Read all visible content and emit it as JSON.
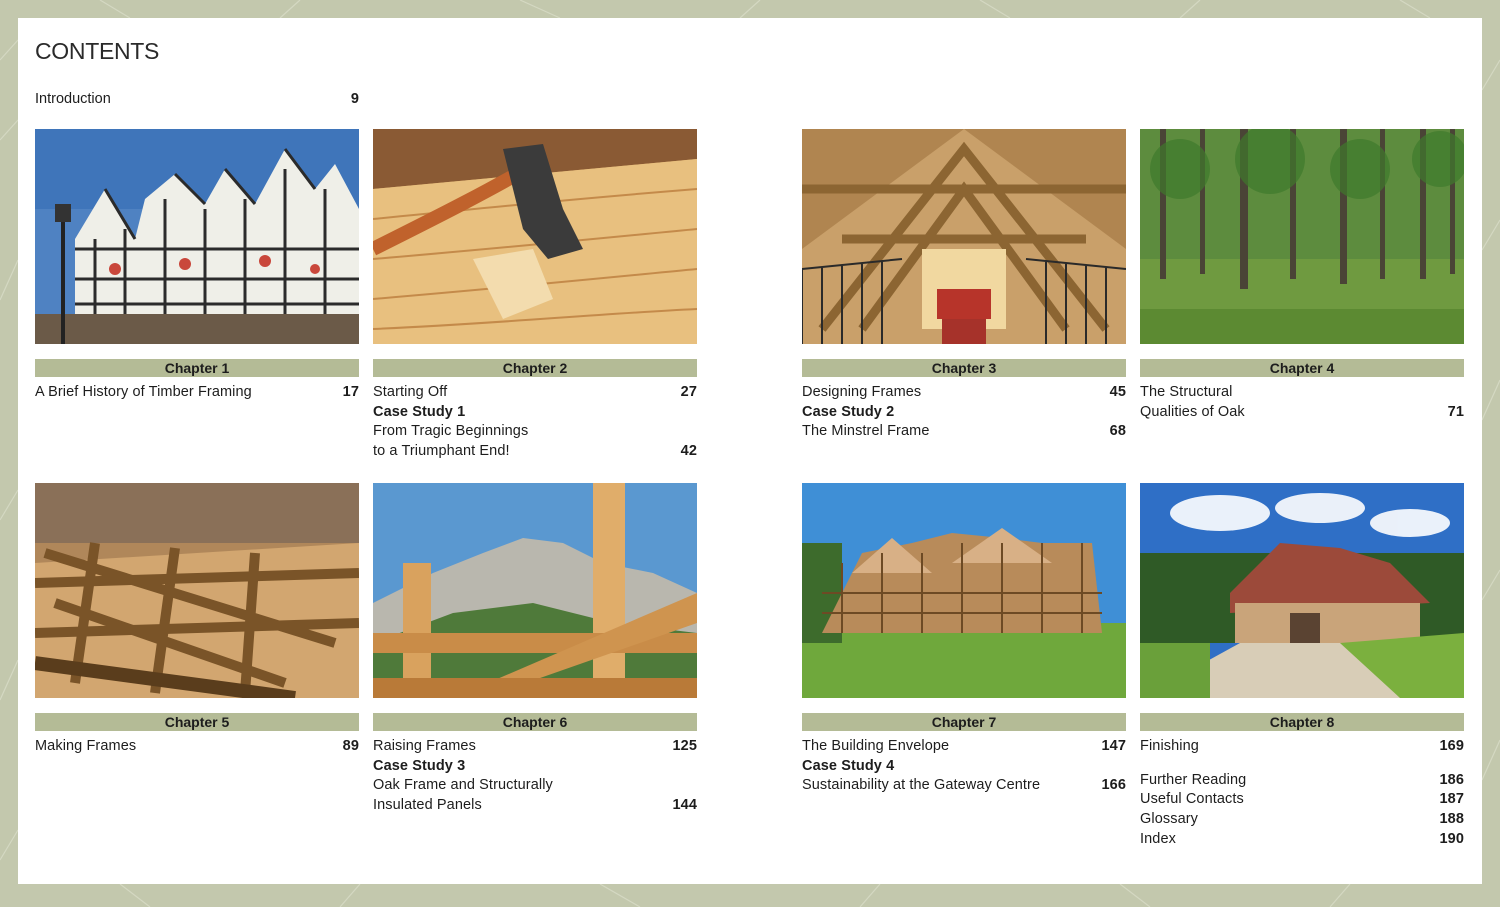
{
  "contents_title": "CONTENTS",
  "introduction": {
    "label": "Introduction",
    "page": "9"
  },
  "chapters": [
    {
      "label": "Chapter 1",
      "photo_icon": "tudor-pub-photo",
      "entries": [
        {
          "text": "A Brief History of Timber Framing",
          "page": "17",
          "bold": false
        }
      ]
    },
    {
      "label": "Chapter 2",
      "photo_icon": "adze-on-timber-photo",
      "entries": [
        {
          "text": "Starting Off",
          "page": "27",
          "bold": false
        },
        {
          "text": "Case Study 1",
          "page": "",
          "bold": true
        },
        {
          "text": "From Tragic Beginnings",
          "page": "",
          "bold": false
        },
        {
          "text": "to a Triumphant End!",
          "page": "42",
          "bold": false
        }
      ]
    },
    {
      "label": "Chapter 3",
      "photo_icon": "oak-frame-interior-photo",
      "entries": [
        {
          "text": "Designing Frames",
          "page": "45",
          "bold": false
        },
        {
          "text": "Case Study 2",
          "page": "",
          "bold": true
        },
        {
          "text": "The Minstrel Frame",
          "page": "68",
          "bold": false
        }
      ]
    },
    {
      "label": "Chapter 4",
      "photo_icon": "oak-forest-photo",
      "entries": [
        {
          "text": "The Structural",
          "page": "",
          "bold": false
        },
        {
          "text": "Qualities of Oak",
          "page": "71",
          "bold": false
        }
      ]
    },
    {
      "label": "Chapter 5",
      "photo_icon": "workshop-frame-photo",
      "entries": [
        {
          "text": "Making Frames",
          "page": "89",
          "bold": false
        }
      ]
    },
    {
      "label": "Chapter 6",
      "photo_icon": "raising-frame-mountains-photo",
      "entries": [
        {
          "text": "Raising Frames",
          "page": "125",
          "bold": false
        },
        {
          "text": "Case Study 3",
          "page": "",
          "bold": true
        },
        {
          "text": "Oak Frame and Structurally",
          "page": "",
          "bold": false
        },
        {
          "text": "Insulated Panels",
          "page": "144",
          "bold": false
        }
      ]
    },
    {
      "label": "Chapter 7",
      "photo_icon": "scaffolded-house-photo",
      "entries": [
        {
          "text": "The Building Envelope",
          "page": "147",
          "bold": false
        },
        {
          "text": "Case Study 4",
          "page": "",
          "bold": true
        },
        {
          "text": "Sustainability at the Gateway Centre",
          "page": "166",
          "bold": false
        }
      ]
    },
    {
      "label": "Chapter 8",
      "photo_icon": "finished-house-photo",
      "entries": [
        {
          "text": "Finishing",
          "page": "169",
          "bold": false
        },
        {
          "text": "Further Reading",
          "page": "186",
          "bold": false,
          "gap": true
        },
        {
          "text": "Useful Contacts",
          "page": "187",
          "bold": false
        },
        {
          "text": "Glossary",
          "page": "188",
          "bold": false
        },
        {
          "text": "Index",
          "page": "190",
          "bold": false
        }
      ]
    }
  ],
  "colors": {
    "background": "#c3c8ad",
    "band": "#b4bb96",
    "page": "#ffffff",
    "text": "#1d1d1d"
  }
}
